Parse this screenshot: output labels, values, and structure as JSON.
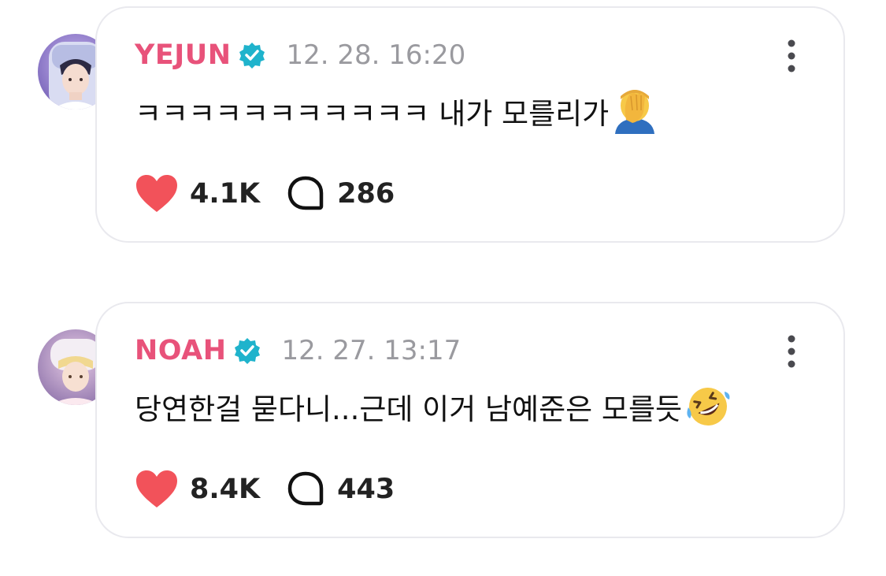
{
  "posts": [
    {
      "username": "YEJUN",
      "timestamp": "12. 28. 16:20",
      "comment": "ㅋㅋㅋㅋㅋㅋㅋㅋㅋㅋㅋ 내가 모를리가",
      "emoji": "face-palm-icon",
      "likes": "4.1K",
      "replies": "286",
      "verified": true
    },
    {
      "username": "NOAH",
      "timestamp": "12. 27. 13:17",
      "comment": "당연한걸 묻다니...근데 이거 남예준은 모를듯",
      "emoji": "rolling-on-floor-laughing-icon",
      "likes": "8.4K",
      "replies": "443",
      "verified": true
    }
  ],
  "colors": {
    "username": "#e8527a",
    "verified": "#1fb3cc",
    "heart": "#f2525a",
    "timestamp": "#9a9a9f",
    "card_border": "#e9e9ee"
  }
}
